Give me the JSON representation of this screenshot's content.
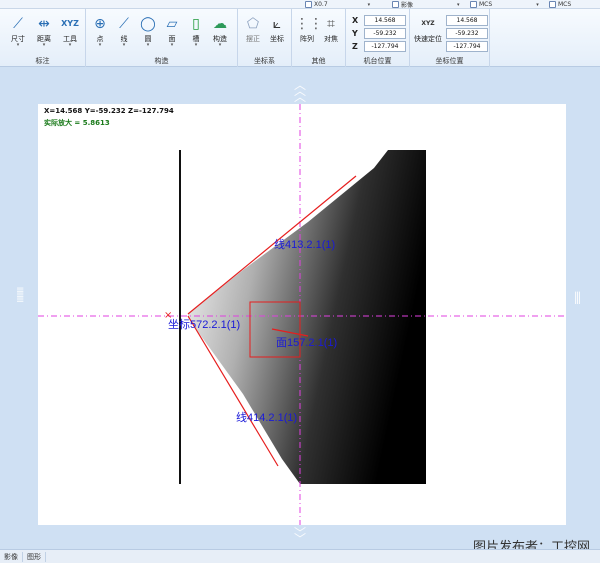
{
  "topbar": {
    "zoom_combo": "X0.7",
    "image_combo": "影像",
    "coord_combo_1": "MCS",
    "coord_combo_2": "MCS"
  },
  "ribbon": {
    "groups": [
      {
        "label": "标注",
        "buttons": [
          "尺寸",
          "距离",
          "工具"
        ]
      },
      {
        "label": "构造",
        "buttons": [
          "点",
          "线",
          "圆",
          "面",
          "槽",
          "构造"
        ]
      },
      {
        "label": "坐标系",
        "buttons": [
          "摆正",
          "坐标"
        ]
      },
      {
        "label": "其他",
        "buttons": [
          "阵列",
          "对焦"
        ]
      },
      {
        "label": "机台位置"
      },
      {
        "label": "坐标位置",
        "buttons": [
          "快速定位"
        ]
      }
    ],
    "machine_position": {
      "x_label": "X",
      "y_label": "Y",
      "z_label": "Z",
      "x": "14.568",
      "y": "-59.232",
      "z": "-127.794"
    },
    "coord_position": {
      "x": "14.568",
      "y": "-59.232",
      "z": "-127.794"
    },
    "xyz_icon_text": "XYZ"
  },
  "canvas": {
    "coord_readout": "X=14.568 Y=-59.232 Z=-127.794",
    "zoom_readout": "实际放大 = 5.8613",
    "labels": {
      "line413": "线413.2.1(1)",
      "line414": "线414.2.1(1)",
      "face157": "面157.2.1(1)",
      "overlap": "坐标572.2.1(1)"
    },
    "colors": {
      "measure_red": "#e61e1e",
      "label_blue": "#1a1ad8",
      "axis_magenta": "#e040e0"
    }
  },
  "statusbar": {
    "items": [
      "影像",
      "图形"
    ]
  },
  "watermark": "图片发布者：工控网"
}
